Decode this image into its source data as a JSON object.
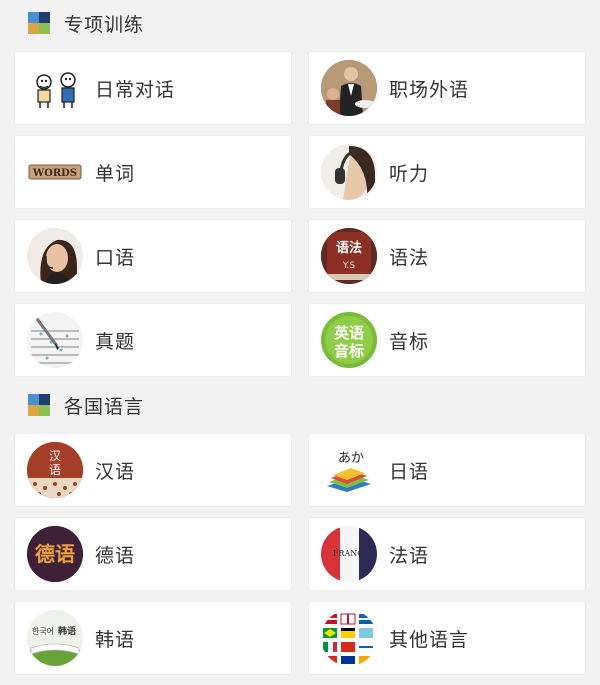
{
  "sections": [
    {
      "title": "专项训练",
      "items": [
        {
          "label": "日常对话",
          "icon": "daily-conversation-icon"
        },
        {
          "label": "职场外语",
          "icon": "workplace-icon"
        },
        {
          "label": "单词",
          "icon": "words-icon"
        },
        {
          "label": "听力",
          "icon": "headphones-icon"
        },
        {
          "label": "口语",
          "icon": "headset-speaker-icon"
        },
        {
          "label": "语法",
          "icon": "grammar-book-icon"
        },
        {
          "label": "真题",
          "icon": "exam-sheet-icon"
        },
        {
          "label": "音标",
          "icon": "phonetics-icon"
        }
      ]
    },
    {
      "title": "各国语言",
      "items": [
        {
          "label": "汉语",
          "icon": "chinese-icon"
        },
        {
          "label": "日语",
          "icon": "japanese-icon"
        },
        {
          "label": "德语",
          "icon": "german-icon"
        },
        {
          "label": "法语",
          "icon": "french-flag-icon"
        },
        {
          "label": "韩语",
          "icon": "korean-book-icon"
        },
        {
          "label": "其他语言",
          "icon": "world-flags-icon"
        }
      ]
    }
  ],
  "thumb_text": {
    "words": "WORDS",
    "grammar_top": "语法",
    "grammar_bottom": "Y.S",
    "phonetics_top": "英语",
    "phonetics_bottom": "音标",
    "chinese_top": "汉",
    "chinese_bottom": "语",
    "japanese": "あか",
    "german": "德语",
    "french": "FRANÇA",
    "korean_a": "한국어",
    "korean_b": "韩语"
  },
  "colors": {
    "background": "#f2f2f2",
    "card": "#ffffff",
    "text": "#333333"
  }
}
